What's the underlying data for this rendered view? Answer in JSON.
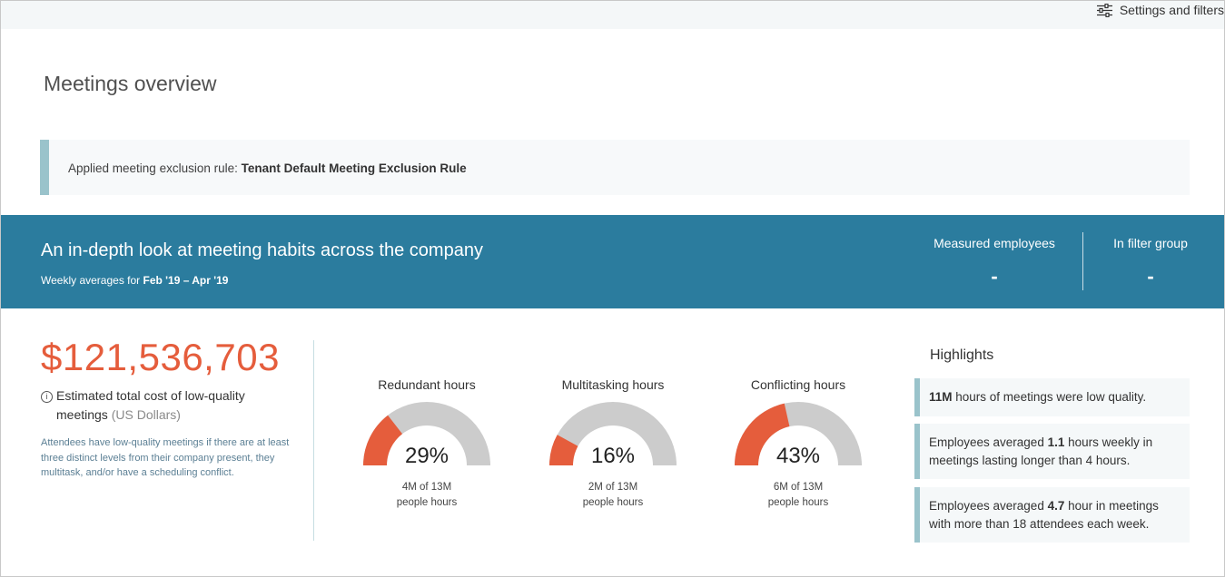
{
  "header": {
    "settings_label": "Settings and filters",
    "settings_icon": "sliders-icon"
  },
  "page": {
    "title": "Meetings overview"
  },
  "exclusion_rule": {
    "label": "Applied meeting exclusion rule: ",
    "value": "Tenant Default Meeting Exclusion Rule"
  },
  "banner": {
    "title": "An in-depth look at meeting habits across the company",
    "subtitle_prefix": "Weekly averages for ",
    "subtitle_range": "Feb '19 – Apr '19",
    "measured_employees_label": "Measured employees",
    "measured_employees_value": "-",
    "in_filter_group_label": "In filter group",
    "in_filter_group_value": "-",
    "color": "#2b7c9e"
  },
  "cost": {
    "amount": "$121,536,703",
    "label": "Estimated total cost of low-quality meetings",
    "unit": "(US Dollars)",
    "description": "Attendees have low-quality meetings if there are at least three distinct levels from their company present, they multitask, and/or have a scheduling conflict.",
    "info_icon": "info-icon",
    "color": "#e55d3c"
  },
  "gauges": [
    {
      "title": "Redundant hours",
      "percent_label": "29%",
      "fraction": 0.29,
      "sub1": "4M of 13M",
      "sub2": "people hours"
    },
    {
      "title": "Multitasking hours",
      "percent_label": "16%",
      "fraction": 0.16,
      "sub1": "2M of 13M",
      "sub2": "people hours"
    },
    {
      "title": "Conflicting hours",
      "percent_label": "43%",
      "fraction": 0.43,
      "sub1": "6M of 13M",
      "sub2": "people hours"
    }
  ],
  "gauge_colors": {
    "fill": "#e55d3c",
    "track": "#cccccc"
  },
  "highlights": {
    "title": "Highlights",
    "items": [
      {
        "bold": "11M",
        "text": " hours of meetings were low quality."
      },
      {
        "pre": "Employees averaged ",
        "bold": "1.1",
        "text": " hours weekly in meetings lasting longer than 4 hours."
      },
      {
        "pre": "Employees averaged ",
        "bold": "4.7",
        "text": " hour in meetings with more than 18 attendees each week."
      }
    ]
  }
}
